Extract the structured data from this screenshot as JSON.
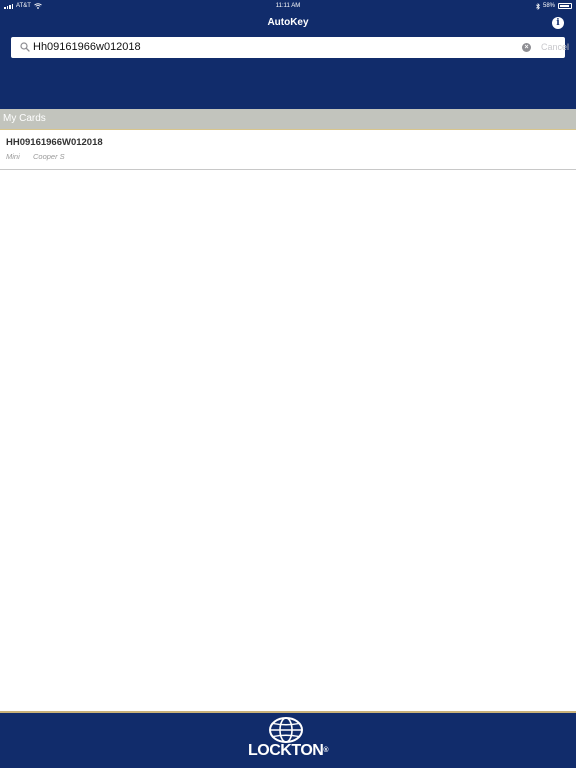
{
  "status_bar": {
    "carrier": "AT&T",
    "time": "11:11 AM",
    "battery": "58%"
  },
  "header": {
    "title": "AutoKey"
  },
  "search": {
    "value": "Hh09161966w012018",
    "cancel_label": "Cancel"
  },
  "section": {
    "title": "My Cards"
  },
  "cards": [
    {
      "id": "HH09161966W012018",
      "make": "Mini",
      "model": "Cooper S"
    }
  ],
  "footer": {
    "logo_text": "LOCKTON",
    "registered_mark": "®"
  },
  "colors": {
    "brand_navy": "#112c6b",
    "section_gray": "#c2c4bd",
    "accent_gold": "#c9b27a"
  }
}
